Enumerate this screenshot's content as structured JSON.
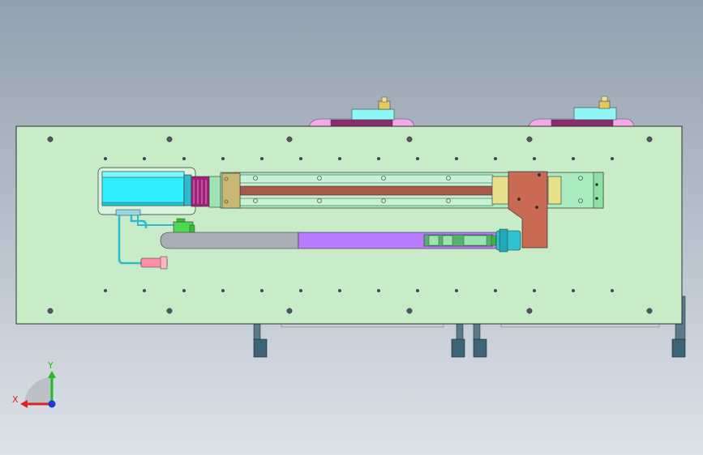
{
  "colors": {
    "plate": "#c8ecc8",
    "plate_edge": "#2f2f2f",
    "motor": "#33eeff",
    "coupling": "#a0207a",
    "rail_body": "#9fe3b4",
    "screw": "#a85a4a",
    "carriage": "#c96a55",
    "cable_chain": "#b97bff",
    "cable_gray": "#a9aeb6",
    "connector_green": "#4fd84f",
    "connector_pink": "#ff8fa6",
    "foot": "#4e6a7a",
    "axis_x": "#e0201c",
    "axis_y": "#22bb22",
    "axis_z": "#1a3ad8"
  },
  "triad": {
    "x_label": "X",
    "y_label": "Y"
  }
}
